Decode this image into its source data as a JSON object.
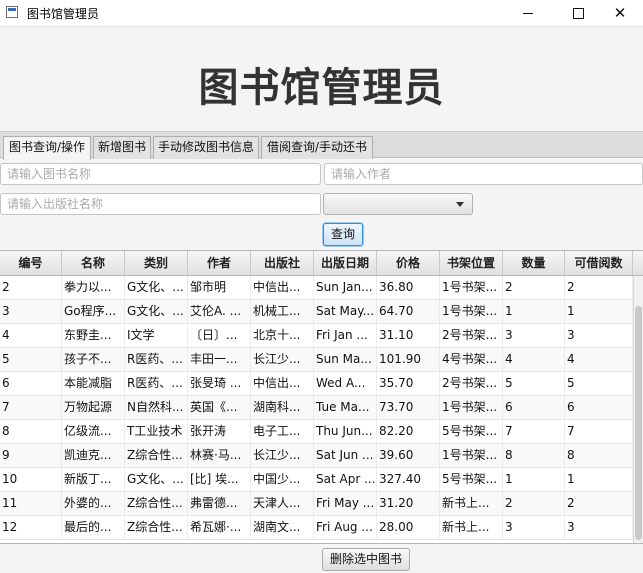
{
  "window": {
    "title": "图书馆管理员",
    "minimize": "",
    "maximize": "",
    "close": "✕"
  },
  "header": {
    "title": "图书馆管理员"
  },
  "tabs": [
    {
      "label": "图书查询/操作"
    },
    {
      "label": "新增图书"
    },
    {
      "label": "手动修改图书信息"
    },
    {
      "label": "借阅查询/手动还书"
    }
  ],
  "search": {
    "book_name_placeholder": "请输入图书名称",
    "author_placeholder": "请输入作者",
    "publisher_placeholder": "请输入出版社名称",
    "category_selected": "",
    "query_label": "查询"
  },
  "table": {
    "columns": [
      "编号",
      "名称",
      "类别",
      "作者",
      "出版社",
      "出版日期",
      "价格",
      "书架位置",
      "数量",
      "可借阅数"
    ],
    "rows": [
      [
        "2",
        "拳力以...",
        "G文化、...",
        "邹市明",
        "中信出...",
        "Sun Jan...",
        "36.80",
        "1号书架...",
        "2",
        "2"
      ],
      [
        "3",
        "Go程序...",
        "G文化、...",
        "艾伦A. ...",
        "机械工...",
        "Sat May...",
        "64.70",
        "1号书架...",
        "1",
        "1"
      ],
      [
        "4",
        "东野圭...",
        "I文学",
        "〔日〕...",
        "北京十...",
        "Fri Jan ...",
        "31.10",
        "2号书架...",
        "3",
        "3"
      ],
      [
        "5",
        "孩子不...",
        "R医药、...",
        "丰田一...",
        "长江少...",
        "Sun Ma...",
        "101.90",
        "4号书架...",
        "4",
        "4"
      ],
      [
        "6",
        "本能减脂",
        "R医药、...",
        "张旻琦 ...",
        "中信出...",
        "Wed A...",
        "35.70",
        "2号书架...",
        "5",
        "5"
      ],
      [
        "7",
        "万物起源",
        "N自然科...",
        "英国《...",
        "湖南科...",
        "Tue Ma...",
        "73.70",
        "1号书架...",
        "6",
        "6"
      ],
      [
        "8",
        "亿级流...",
        "T工业技术",
        "张开涛",
        "电子工...",
        "Thu Jun...",
        "82.20",
        "5号书架...",
        "7",
        "7"
      ],
      [
        "9",
        "凯迪克...",
        "Z综合性...",
        "林赛·马...",
        "长江少...",
        "Sat Jun ...",
        "39.60",
        "1号书架...",
        "8",
        "8"
      ],
      [
        "10",
        "新版丁...",
        "G文化、...",
        "[比] 埃...",
        "中国少...",
        "Sat Apr ...",
        "327.40",
        "5号书架...",
        "1",
        "1"
      ],
      [
        "11",
        "外婆的...",
        "Z综合性...",
        "弗雷德...",
        "天津人...",
        "Fri May ...",
        "31.20",
        "新书上...",
        "2",
        "2"
      ],
      [
        "12",
        "最后的...",
        "Z综合性...",
        "希瓦娜·...",
        "湖南文...",
        "Fri Aug ...",
        "28.00",
        "新书上...",
        "3",
        "3"
      ]
    ]
  },
  "footer": {
    "delete_label": "删除选中图书"
  }
}
